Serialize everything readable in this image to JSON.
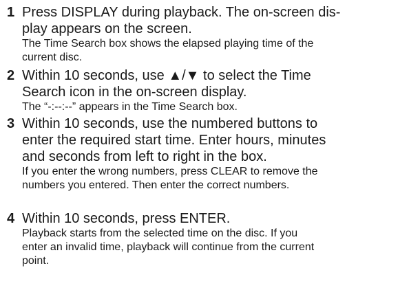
{
  "steps": [
    {
      "number": "1",
      "instruction": "Press DISPLAY during playback. The on-screen dis-\nplay appears on the screen.",
      "note": "The Time Search box shows the elapsed playing time of the\ncurrent disc."
    },
    {
      "number": "2",
      "instruction": "Within 10 seconds, use ▲/▼ to select the Time\nSearch icon in the on-screen display.",
      "note": "The “-:--:--” appears in the Time Search box."
    },
    {
      "number": "3",
      "instruction": "Within 10 seconds, use the numbered buttons to\nenter the required start time. Enter hours, minutes\nand seconds from left to right in the box.",
      "note": "If you enter the wrong numbers, press CLEAR to remove the\nnumbers you entered. Then enter the correct numbers."
    },
    {
      "number": "4",
      "instruction": "Within 10 seconds, press ENTER.",
      "note": "Playback starts from the selected time on the disc. If you\nenter an invalid time, playback will continue from the current\npoint."
    }
  ]
}
